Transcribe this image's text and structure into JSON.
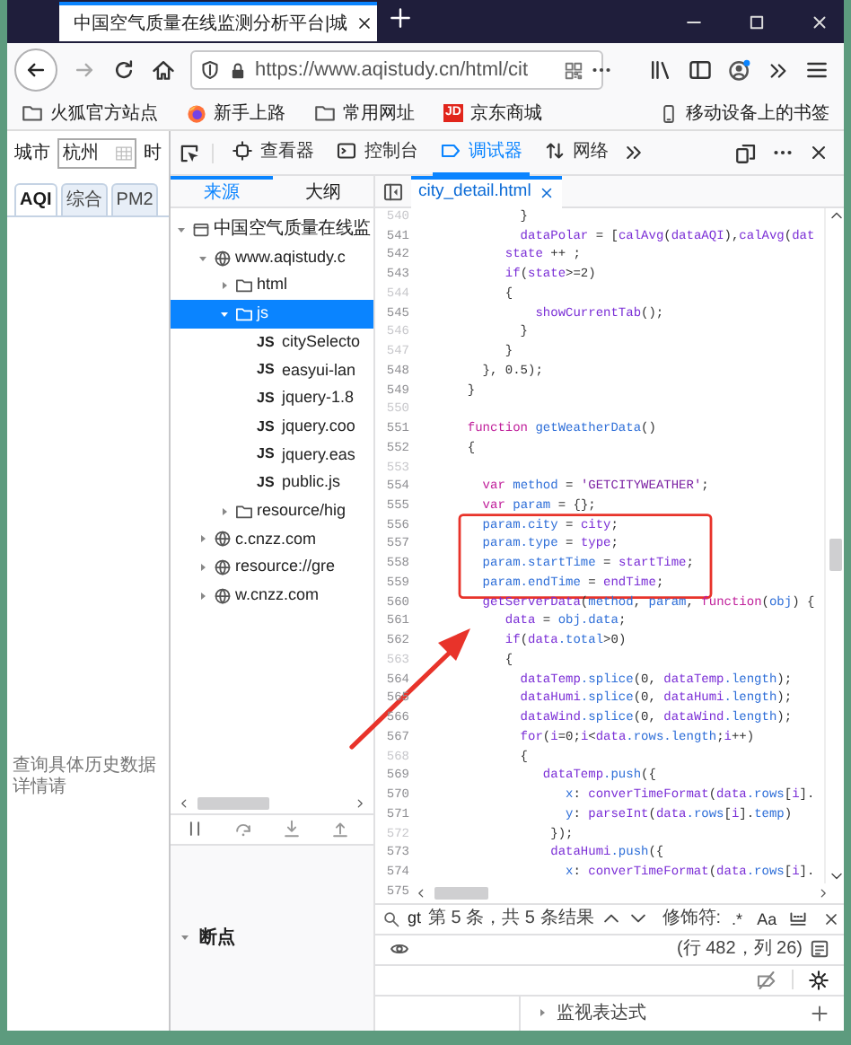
{
  "browser": {
    "tab": {
      "title": "中国空气质量在线监测分析平台|城",
      "selected": true
    },
    "url": "https://www.aqistudy.cn/html/cit",
    "bookmarks": [
      {
        "label": "火狐官方站点",
        "kind": "folder"
      },
      {
        "label": "新手上路",
        "kind": "firefox"
      },
      {
        "label": "常用网址",
        "kind": "folder"
      },
      {
        "label": "京东商城",
        "kind": "logo",
        "logo_text": "JD"
      }
    ],
    "mobile_bookmarks": "移动设备上的书签"
  },
  "page": {
    "city_label": "城市",
    "city_value": "杭州",
    "next_label": "时",
    "tabs": [
      {
        "label": "AQI",
        "selected": true
      },
      {
        "label": "综合",
        "selected": false
      },
      {
        "label": "PM2",
        "selected": false
      }
    ],
    "note": "查询具体历史数据详情请"
  },
  "devtools": {
    "tabs": [
      {
        "label": "查看器",
        "kind": "inspector",
        "selected": false
      },
      {
        "label": "控制台",
        "kind": "console",
        "selected": false
      },
      {
        "label": "调试器",
        "kind": "debugger",
        "selected": true
      },
      {
        "label": "网络",
        "kind": "network",
        "selected": false
      }
    ],
    "sources": {
      "tabs": [
        {
          "label": "来源",
          "selected": true
        },
        {
          "label": "大纲",
          "selected": false
        }
      ],
      "tree": [
        {
          "label": "中国空气质量在线监",
          "kind": "page",
          "expanded": true,
          "selected": false,
          "children": [
            {
              "label": "www.aqistudy.c",
              "kind": "domain",
              "expanded": true,
              "selected": false,
              "children": [
                {
                  "label": "html",
                  "kind": "folder",
                  "expanded": false,
                  "selected": false
                },
                {
                  "label": "js",
                  "kind": "folder",
                  "expanded": true,
                  "selected": true,
                  "children": [
                    {
                      "label": "citySelecto",
                      "kind": "file",
                      "badge": "JS",
                      "selected": false
                    },
                    {
                      "label": "easyui-lan",
                      "kind": "file",
                      "badge": "JS",
                      "selected": false
                    },
                    {
                      "label": "jquery-1.8",
                      "kind": "file",
                      "badge": "JS",
                      "selected": false
                    },
                    {
                      "label": "jquery.coo",
                      "kind": "file",
                      "badge": "JS",
                      "selected": false
                    },
                    {
                      "label": "jquery.eas",
                      "kind": "file",
                      "badge": "JS",
                      "selected": false
                    },
                    {
                      "label": "public.js",
                      "kind": "file",
                      "badge": "JS",
                      "selected": false
                    }
                  ]
                },
                {
                  "label": "resource/hig",
                  "kind": "folder",
                  "expanded": false,
                  "selected": false
                }
              ]
            },
            {
              "label": "c.cnzz.com",
              "kind": "domain",
              "expanded": false,
              "selected": false
            },
            {
              "label": "resource://gre",
              "kind": "domain",
              "expanded": false,
              "selected": false
            },
            {
              "label": "w.cnzz.com",
              "kind": "domain",
              "expanded": false,
              "selected": false
            }
          ]
        }
      ]
    },
    "breakpoints": {
      "label": "断点",
      "expanded": true
    },
    "editor": {
      "file_tab": "city_detail.html",
      "lines": [
        {
          "number": "540",
          "breakable": false,
          "boxed": false,
          "code": [
            {
              "kind": "p",
              "text": "              }"
            }
          ]
        },
        {
          "number": "541",
          "breakable": true,
          "boxed": false,
          "code": [
            {
              "kind": "v",
              "text": "              dataPolar"
            },
            {
              "kind": "p",
              "text": " = ["
            },
            {
              "kind": "v",
              "text": "calAvg"
            },
            {
              "kind": "p",
              "text": "("
            },
            {
              "kind": "v",
              "text": "dataAQI"
            },
            {
              "kind": "p",
              "text": "),"
            },
            {
              "kind": "v",
              "text": "calAvg"
            },
            {
              "kind": "p",
              "text": "("
            },
            {
              "kind": "v",
              "text": "dat"
            }
          ]
        },
        {
          "number": "542",
          "breakable": true,
          "boxed": false,
          "code": [
            {
              "kind": "v",
              "text": "            state"
            },
            {
              "kind": "p",
              "text": " ++ ;"
            }
          ]
        },
        {
          "number": "543",
          "breakable": true,
          "boxed": false,
          "code": [
            {
              "kind": "v",
              "text": "            if"
            },
            {
              "kind": "p",
              "text": "("
            },
            {
              "kind": "v",
              "text": "state"
            },
            {
              "kind": "p",
              "text": ">=2)"
            }
          ]
        },
        {
          "number": "544",
          "breakable": false,
          "boxed": false,
          "code": [
            {
              "kind": "p",
              "text": "            {"
            }
          ]
        },
        {
          "number": "545",
          "breakable": true,
          "boxed": false,
          "code": [
            {
              "kind": "v",
              "text": "                showCurrentTab"
            },
            {
              "kind": "p",
              "text": "();"
            }
          ]
        },
        {
          "number": "546",
          "breakable": false,
          "boxed": false,
          "code": [
            {
              "kind": "p",
              "text": "              }"
            }
          ]
        },
        {
          "number": "547",
          "breakable": false,
          "boxed": false,
          "code": [
            {
              "kind": "p",
              "text": "            }"
            }
          ]
        },
        {
          "number": "548",
          "breakable": true,
          "boxed": false,
          "code": [
            {
              "kind": "p",
              "text": "         }, 0.5);"
            }
          ]
        },
        {
          "number": "549",
          "breakable": true,
          "boxed": false,
          "code": [
            {
              "kind": "p",
              "text": "       }"
            }
          ]
        },
        {
          "number": "550",
          "breakable": false,
          "boxed": false
        },
        {
          "number": "551",
          "breakable": true,
          "boxed": false,
          "code": [
            {
              "kind": "k",
              "text": "       function"
            },
            {
              "kind": "d",
              "text": " getWeatherData"
            },
            {
              "kind": "p",
              "text": "()"
            }
          ]
        },
        {
          "number": "552",
          "breakable": true,
          "boxed": false,
          "code": [
            {
              "kind": "p",
              "text": "       {"
            }
          ]
        },
        {
          "number": "553",
          "breakable": false,
          "boxed": false
        },
        {
          "number": "554",
          "breakable": true,
          "boxed": false,
          "code": [
            {
              "kind": "k",
              "text": "         var"
            },
            {
              "kind": "d",
              "text": " method"
            },
            {
              "kind": "p",
              "text": " = "
            },
            {
              "kind": "s",
              "text": "'GETCITYWEATHER'"
            },
            {
              "kind": "p",
              "text": ";"
            }
          ]
        },
        {
          "number": "555",
          "breakable": true,
          "boxed": false,
          "code": [
            {
              "kind": "k",
              "text": "         var"
            },
            {
              "kind": "d",
              "text": " param"
            },
            {
              "kind": "p",
              "text": " = {};"
            }
          ]
        },
        {
          "number": "556",
          "breakable": true,
          "boxed": true,
          "code": [
            {
              "kind": "d",
              "text": "         param.city"
            },
            {
              "kind": "p",
              "text": " = "
            },
            {
              "kind": "v",
              "text": "city"
            },
            {
              "kind": "p",
              "text": ";"
            }
          ]
        },
        {
          "number": "557",
          "breakable": true,
          "boxed": true,
          "code": [
            {
              "kind": "d",
              "text": "         param.type"
            },
            {
              "kind": "p",
              "text": " = "
            },
            {
              "kind": "v",
              "text": "type"
            },
            {
              "kind": "p",
              "text": ";"
            }
          ]
        },
        {
          "number": "558",
          "breakable": true,
          "boxed": true,
          "code": [
            {
              "kind": "d",
              "text": "         param.startTime"
            },
            {
              "kind": "p",
              "text": " = "
            },
            {
              "kind": "v",
              "text": "startTime"
            },
            {
              "kind": "p",
              "text": ";"
            }
          ]
        },
        {
          "number": "559",
          "breakable": true,
          "boxed": true,
          "code": [
            {
              "kind": "d",
              "text": "         param.endTime"
            },
            {
              "kind": "p",
              "text": " = "
            },
            {
              "kind": "v",
              "text": "endTime"
            },
            {
              "kind": "p",
              "text": ";"
            }
          ]
        },
        {
          "number": "560",
          "breakable": true,
          "boxed": false,
          "code": [
            {
              "kind": "v",
              "text": "         getServerData"
            },
            {
              "kind": "p",
              "text": "("
            },
            {
              "kind": "d",
              "text": "method"
            },
            {
              "kind": "p",
              "text": ", "
            },
            {
              "kind": "d",
              "text": "param"
            },
            {
              "kind": "p",
              "text": ", "
            },
            {
              "kind": "k",
              "text": "function"
            },
            {
              "kind": "p",
              "text": "("
            },
            {
              "kind": "d",
              "text": "obj"
            },
            {
              "kind": "p",
              "text": ") {"
            }
          ]
        },
        {
          "number": "561",
          "breakable": true,
          "boxed": false,
          "code": [
            {
              "kind": "v",
              "text": "            data"
            },
            {
              "kind": "p",
              "text": " = "
            },
            {
              "kind": "d",
              "text": "obj.data"
            },
            {
              "kind": "p",
              "text": ";"
            }
          ]
        },
        {
          "number": "562",
          "breakable": true,
          "boxed": false,
          "code": [
            {
              "kind": "v",
              "text": "            if"
            },
            {
              "kind": "p",
              "text": "("
            },
            {
              "kind": "v",
              "text": "data"
            },
            {
              "kind": "d",
              "text": ".total"
            },
            {
              "kind": "p",
              "text": ">0)"
            }
          ]
        },
        {
          "number": "563",
          "breakable": false,
          "boxed": false,
          "code": [
            {
              "kind": "p",
              "text": "            {"
            }
          ]
        },
        {
          "number": "564",
          "breakable": true,
          "boxed": false,
          "code": [
            {
              "kind": "v",
              "text": "              dataTemp"
            },
            {
              "kind": "d",
              "text": ".splice"
            },
            {
              "kind": "p",
              "text": "(0, "
            },
            {
              "kind": "v",
              "text": "dataTemp"
            },
            {
              "kind": "d",
              "text": ".length"
            },
            {
              "kind": "p",
              "text": ");"
            }
          ]
        },
        {
          "number": "565",
          "breakable": true,
          "boxed": false,
          "code": [
            {
              "kind": "v",
              "text": "              dataHumi"
            },
            {
              "kind": "d",
              "text": ".splice"
            },
            {
              "kind": "p",
              "text": "(0, "
            },
            {
              "kind": "v",
              "text": "dataHumi"
            },
            {
              "kind": "d",
              "text": ".length"
            },
            {
              "kind": "p",
              "text": ");"
            }
          ]
        },
        {
          "number": "566",
          "breakable": true,
          "boxed": false,
          "code": [
            {
              "kind": "v",
              "text": "              dataWind"
            },
            {
              "kind": "d",
              "text": ".splice"
            },
            {
              "kind": "p",
              "text": "(0, "
            },
            {
              "kind": "v",
              "text": "dataWind"
            },
            {
              "kind": "d",
              "text": ".length"
            },
            {
              "kind": "p",
              "text": ");"
            }
          ]
        },
        {
          "number": "567",
          "breakable": true,
          "boxed": false,
          "code": [
            {
              "kind": "v",
              "text": "              for"
            },
            {
              "kind": "p",
              "text": "("
            },
            {
              "kind": "v",
              "text": "i"
            },
            {
              "kind": "p",
              "text": "=0;"
            },
            {
              "kind": "v",
              "text": "i"
            },
            {
              "kind": "p",
              "text": "<"
            },
            {
              "kind": "v",
              "text": "data"
            },
            {
              "kind": "d",
              "text": ".rows.length"
            },
            {
              "kind": "p",
              "text": ";"
            },
            {
              "kind": "v",
              "text": "i"
            },
            {
              "kind": "p",
              "text": "++)"
            }
          ]
        },
        {
          "number": "568",
          "breakable": false,
          "boxed": false,
          "code": [
            {
              "kind": "p",
              "text": "              {"
            }
          ]
        },
        {
          "number": "569",
          "breakable": true,
          "boxed": false,
          "code": [
            {
              "kind": "v",
              "text": "                 dataTemp"
            },
            {
              "kind": "d",
              "text": ".push"
            },
            {
              "kind": "p",
              "text": "({"
            }
          ]
        },
        {
          "number": "570",
          "breakable": true,
          "boxed": false,
          "code": [
            {
              "kind": "d",
              "text": "                    x"
            },
            {
              "kind": "p",
              "text": ": "
            },
            {
              "kind": "v",
              "text": "converTimeFormat"
            },
            {
              "kind": "p",
              "text": "("
            },
            {
              "kind": "v",
              "text": "data"
            },
            {
              "kind": "d",
              "text": ".rows"
            },
            {
              "kind": "p",
              "text": "["
            },
            {
              "kind": "v",
              "text": "i"
            },
            {
              "kind": "p",
              "text": "]."
            }
          ]
        },
        {
          "number": "571",
          "breakable": true,
          "boxed": false,
          "code": [
            {
              "kind": "d",
              "text": "                    y"
            },
            {
              "kind": "p",
              "text": ": "
            },
            {
              "kind": "v",
              "text": "parseInt"
            },
            {
              "kind": "p",
              "text": "("
            },
            {
              "kind": "v",
              "text": "data"
            },
            {
              "kind": "d",
              "text": ".rows"
            },
            {
              "kind": "p",
              "text": "["
            },
            {
              "kind": "v",
              "text": "i"
            },
            {
              "kind": "p",
              "text": "]."
            },
            {
              "kind": "d",
              "text": "temp"
            },
            {
              "kind": "p",
              "text": ")"
            }
          ]
        },
        {
          "number": "572",
          "breakable": false,
          "boxed": false,
          "code": [
            {
              "kind": "p",
              "text": "                  });"
            }
          ]
        },
        {
          "number": "573",
          "breakable": true,
          "boxed": false,
          "code": [
            {
              "kind": "v",
              "text": "                  dataHumi"
            },
            {
              "kind": "d",
              "text": ".push"
            },
            {
              "kind": "p",
              "text": "({"
            }
          ]
        },
        {
          "number": "574",
          "breakable": true,
          "boxed": false,
          "code": [
            {
              "kind": "d",
              "text": "                    x"
            },
            {
              "kind": "p",
              "text": ": "
            },
            {
              "kind": "v",
              "text": "converTimeFormat"
            },
            {
              "kind": "p",
              "text": "("
            },
            {
              "kind": "v",
              "text": "data"
            },
            {
              "kind": "d",
              "text": ".rows"
            },
            {
              "kind": "p",
              "text": "["
            },
            {
              "kind": "v",
              "text": "i"
            },
            {
              "kind": "p",
              "text": "]."
            }
          ]
        }
      ],
      "partial_line_number": "575"
    },
    "search": {
      "query": "gt",
      "result": "第 5 条，共 5 条结果",
      "modifiers_label": "修饰符:",
      "regex": ".*",
      "match_case": "Aa"
    },
    "cursor_position": "(行 482，列 26)",
    "watch": {
      "label": "监视表达式",
      "expanded": false
    }
  }
}
